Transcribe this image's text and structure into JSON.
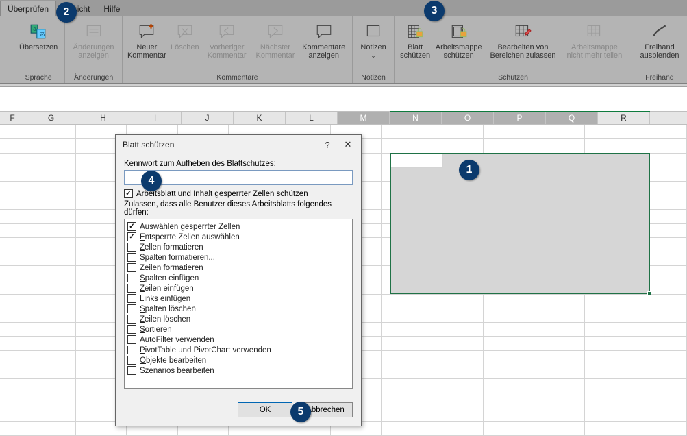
{
  "tabs": {
    "review": "Überprüfen",
    "view": "Ansicht",
    "help": "Hilfe"
  },
  "ribbon": {
    "sprache": {
      "group": "Sprache",
      "translate": "Übersetzen"
    },
    "aenderungen": {
      "group": "Änderungen",
      "show": "Änderungen anzeigen"
    },
    "kommentare": {
      "group": "Kommentare",
      "new": "Neuer Kommentar",
      "delete": "Löschen",
      "prev": "Vorheriger Kommentar",
      "next": "Nächster Kommentar",
      "show": "Kommentare anzeigen"
    },
    "notizen": {
      "group": "Notizen",
      "notes": "Notizen"
    },
    "schuetzen": {
      "group": "Schützen",
      "sheet": "Blatt schützen",
      "book": "Arbeitsmappe schützen",
      "ranges": "Bearbeiten von Bereichen zulassen",
      "unshare": "Arbeitsmappe nicht mehr teilen"
    },
    "freihand": {
      "group": "Freihand",
      "hide": "Freihand ausblenden"
    }
  },
  "columns": [
    "F",
    "G",
    "H",
    "I",
    "J",
    "K",
    "L",
    "M",
    "N",
    "O",
    "P",
    "Q",
    "R"
  ],
  "dialog": {
    "title": "Blatt schützen",
    "pwd_label": "Kennwort zum Aufheben des Blattschutzes:",
    "protect_check": "Arbeitsblatt und Inhalt gesperrter Zellen schützen",
    "allow_label": "Zulassen, dass alle Benutzer dieses Arbeitsblatts folgendes dürfen:",
    "perms": [
      {
        "label": "Auswählen gesperrter Zellen",
        "checked": true
      },
      {
        "label": "Entsperrte Zellen auswählen",
        "checked": true
      },
      {
        "label": "Zellen formatieren",
        "checked": false
      },
      {
        "label": "Spalten formatieren...",
        "checked": false
      },
      {
        "label": "Zeilen formatieren",
        "checked": false
      },
      {
        "label": "Spalten einfügen",
        "checked": false
      },
      {
        "label": "Zeilen einfügen",
        "checked": false
      },
      {
        "label": "Links einfügen",
        "checked": false
      },
      {
        "label": "Spalten löschen",
        "checked": false
      },
      {
        "label": "Zeilen löschen",
        "checked": false
      },
      {
        "label": "Sortieren",
        "checked": false
      },
      {
        "label": "AutoFilter verwenden",
        "checked": false
      },
      {
        "label": "PivotTable und PivotChart verwenden",
        "checked": false
      },
      {
        "label": "Objekte bearbeiten",
        "checked": false
      },
      {
        "label": "Szenarios bearbeiten",
        "checked": false
      }
    ],
    "ok": "OK",
    "cancel": "Abbrechen"
  },
  "badges": {
    "b1": "1",
    "b2": "2",
    "b3": "3",
    "b4": "4",
    "b5": "5"
  }
}
